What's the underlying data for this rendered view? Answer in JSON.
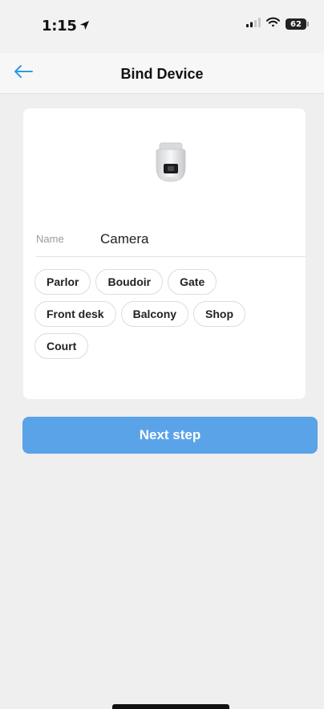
{
  "status_bar": {
    "time": "1:15",
    "battery_level": "62"
  },
  "header": {
    "title": "Bind Device",
    "accent_color": "#2e9be6"
  },
  "device": {
    "image_icon": "dome-camera-icon",
    "name_label": "Name",
    "name_value": "Camera"
  },
  "tags": [
    "Parlor",
    "Boudoir",
    "Gate",
    "Front desk",
    "Balcony",
    "Shop",
    "Court"
  ],
  "next_button": {
    "label": "Next step",
    "color": "#5ba3e8"
  }
}
